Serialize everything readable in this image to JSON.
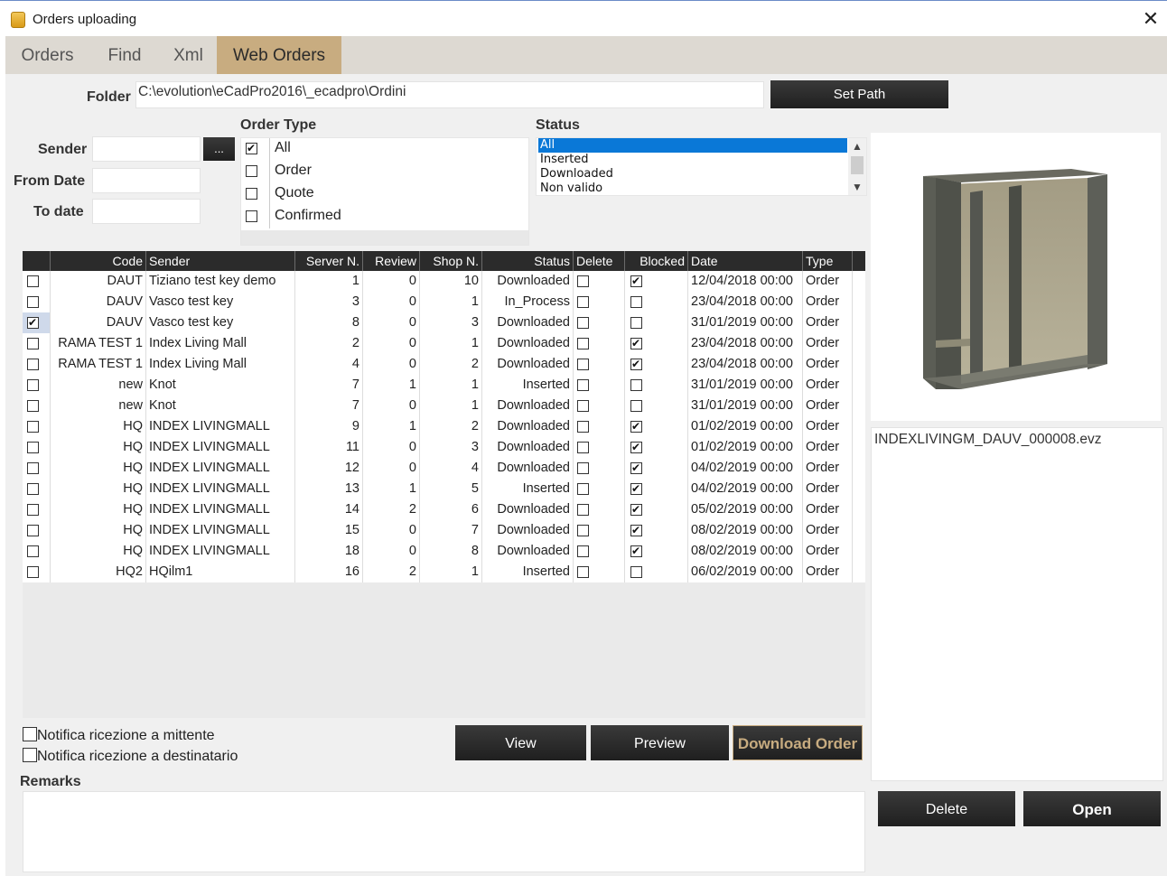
{
  "window": {
    "title": "Orders uploading",
    "close_label": "✕"
  },
  "tabs": [
    {
      "label": "Orders"
    },
    {
      "label": "Find"
    },
    {
      "label": "Xml"
    },
    {
      "label": "Web Orders",
      "active": true
    }
  ],
  "folder": {
    "label": "Folder",
    "value": "C:\\evolution\\eCadPro2016\\_ecadpro\\Ordini",
    "set_path_label": "Set Path"
  },
  "filters": {
    "sender_label": "Sender",
    "sender_value": "",
    "browse_label": "...",
    "from_date_label": "From Date",
    "from_date_value": "",
    "to_date_label": "To date",
    "to_date_value": ""
  },
  "order_type": {
    "label": "Order Type",
    "items": [
      {
        "label": "All",
        "checked": true
      },
      {
        "label": "Order",
        "checked": false
      },
      {
        "label": "Quote",
        "checked": false
      },
      {
        "label": "Confirmed",
        "checked": false
      }
    ]
  },
  "status": {
    "label": "Status",
    "items": [
      {
        "label": "All",
        "selected": true
      },
      {
        "label": "Inserted"
      },
      {
        "label": "Downloaded"
      },
      {
        "label": "Non valido"
      }
    ]
  },
  "grid": {
    "columns": [
      "",
      "Code",
      "Sender",
      "Server N.",
      "Review",
      "Shop N.",
      "Status",
      "Delete",
      "Blocked",
      "Date",
      "Type"
    ],
    "rows": [
      {
        "selected": false,
        "code": "DAUT",
        "sender": "Tiziano test key demo",
        "server_n": "1",
        "review": "0",
        "shop_n": "10",
        "status": "Downloaded",
        "delete": false,
        "blocked": true,
        "date": "12/04/2018 00:00",
        "type": "Order"
      },
      {
        "selected": false,
        "code": "DAUV",
        "sender": "Vasco test key",
        "server_n": "3",
        "review": "0",
        "shop_n": "1",
        "status": "In_Process",
        "delete": false,
        "blocked": false,
        "date": "23/04/2018 00:00",
        "type": "Order"
      },
      {
        "selected": true,
        "code": "DAUV",
        "sender": "Vasco test key",
        "server_n": "8",
        "review": "0",
        "shop_n": "3",
        "status": "Downloaded",
        "delete": false,
        "blocked": false,
        "date": "31/01/2019 00:00",
        "type": "Order"
      },
      {
        "selected": false,
        "code": "RAMA TEST 1",
        "sender": "Index Living Mall",
        "server_n": "2",
        "review": "0",
        "shop_n": "1",
        "status": "Downloaded",
        "delete": false,
        "blocked": true,
        "date": "23/04/2018 00:00",
        "type": "Order"
      },
      {
        "selected": false,
        "code": "RAMA TEST 1",
        "sender": "Index Living Mall",
        "server_n": "4",
        "review": "0",
        "shop_n": "2",
        "status": "Downloaded",
        "delete": false,
        "blocked": true,
        "date": "23/04/2018 00:00",
        "type": "Order"
      },
      {
        "selected": false,
        "code": "new",
        "sender": "Knot",
        "server_n": "7",
        "review": "1",
        "shop_n": "1",
        "status": "Inserted",
        "delete": false,
        "blocked": false,
        "date": "31/01/2019 00:00",
        "type": "Order"
      },
      {
        "selected": false,
        "code": "new",
        "sender": "Knot",
        "server_n": "7",
        "review": "0",
        "shop_n": "1",
        "status": "Downloaded",
        "delete": false,
        "blocked": false,
        "date": "31/01/2019 00:00",
        "type": "Order"
      },
      {
        "selected": false,
        "code": "HQ",
        "sender": "INDEX LIVINGMALL",
        "server_n": "9",
        "review": "1",
        "shop_n": "2",
        "status": "Downloaded",
        "delete": false,
        "blocked": true,
        "date": "01/02/2019 00:00",
        "type": "Order"
      },
      {
        "selected": false,
        "code": "HQ",
        "sender": "INDEX LIVINGMALL",
        "server_n": "11",
        "review": "0",
        "shop_n": "3",
        "status": "Downloaded",
        "delete": false,
        "blocked": true,
        "date": "01/02/2019 00:00",
        "type": "Order"
      },
      {
        "selected": false,
        "code": "HQ",
        "sender": "INDEX LIVINGMALL",
        "server_n": "12",
        "review": "0",
        "shop_n": "4",
        "status": "Downloaded",
        "delete": false,
        "blocked": true,
        "date": "04/02/2019 00:00",
        "type": "Order"
      },
      {
        "selected": false,
        "code": "HQ",
        "sender": "INDEX LIVINGMALL",
        "server_n": "13",
        "review": "1",
        "shop_n": "5",
        "status": "Inserted",
        "delete": false,
        "blocked": true,
        "date": "04/02/2019 00:00",
        "type": "Order"
      },
      {
        "selected": false,
        "code": "HQ",
        "sender": "INDEX LIVINGMALL",
        "server_n": "14",
        "review": "2",
        "shop_n": "6",
        "status": "Downloaded",
        "delete": false,
        "blocked": true,
        "date": "05/02/2019 00:00",
        "type": "Order"
      },
      {
        "selected": false,
        "code": "HQ",
        "sender": "INDEX LIVINGMALL",
        "server_n": "15",
        "review": "0",
        "shop_n": "7",
        "status": "Downloaded",
        "delete": false,
        "blocked": true,
        "date": "08/02/2019 00:00",
        "type": "Order"
      },
      {
        "selected": false,
        "code": "HQ",
        "sender": "INDEX LIVINGMALL",
        "server_n": "18",
        "review": "0",
        "shop_n": "8",
        "status": "Downloaded",
        "delete": false,
        "blocked": true,
        "date": "08/02/2019 00:00",
        "type": "Order"
      },
      {
        "selected": false,
        "code": "HQ2",
        "sender": "HQilm1",
        "server_n": "16",
        "review": "2",
        "shop_n": "1",
        "status": "Inserted",
        "delete": false,
        "blocked": false,
        "date": "06/02/2019 00:00",
        "type": "Order"
      }
    ]
  },
  "notifications": {
    "sender_label": "Notifica ricezione a mittente",
    "recipient_label": "Notifica ricezione a destinatario"
  },
  "actions": {
    "view_label": "View",
    "preview_label": "Preview",
    "download_label": "Download Order"
  },
  "remarks": {
    "label": "Remarks",
    "value": ""
  },
  "right_panel": {
    "file_name": "INDEXLIVINGM_DAUV_000008.evz",
    "delete_label": "Delete",
    "open_label": "Open"
  },
  "colors": {
    "active_tab": "#c8ac80",
    "header_dark": "#2b2b2b",
    "selection_blue": "#0a78d7",
    "download_text": "#c8ac80"
  }
}
